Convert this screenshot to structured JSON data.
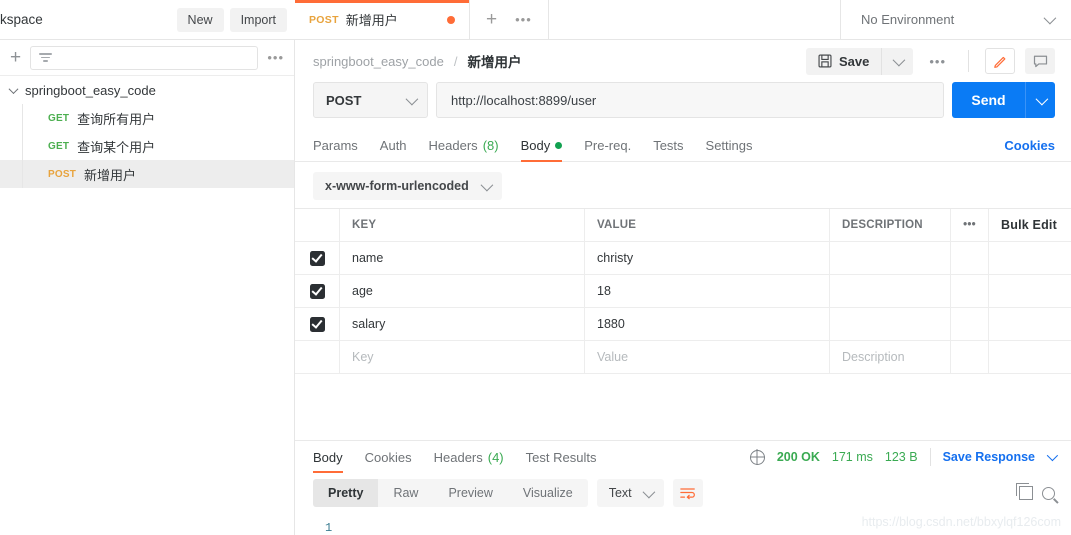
{
  "workspace": {
    "title": "kspace",
    "new_label": "New",
    "import_label": "Import"
  },
  "tabstrip": {
    "tabs": [
      {
        "method": "POST",
        "name": "新增用户",
        "unsaved": true
      }
    ],
    "new_tab_icon": "plus-icon",
    "more_icon": "ellipsis-icon"
  },
  "environment": {
    "selected": "No Environment"
  },
  "sidebar": {
    "add_icon": "plus-icon",
    "filter_placeholder": "",
    "filter_icon": "filter-icon",
    "more_icon": "ellipsis-icon",
    "collection": {
      "name": "springboot_easy_code",
      "expanded": true,
      "requests": [
        {
          "method": "GET",
          "name": "查询所有用户",
          "selected": false
        },
        {
          "method": "GET",
          "name": "查询某个用户",
          "selected": false
        },
        {
          "method": "POST",
          "name": "新增用户",
          "selected": true
        }
      ]
    }
  },
  "breadcrumb": {
    "collection": "springboot_easy_code",
    "separator": "/",
    "request": "新增用户"
  },
  "header_actions": {
    "save_label": "Save",
    "save_icon": "floppy-disk-icon",
    "save_caret_icon": "chevron-down-icon",
    "more_icon": "ellipsis-icon",
    "edit_icon": "pencil-icon",
    "comment_icon": "comment-icon"
  },
  "request": {
    "method": "POST",
    "url": "http://localhost:8899/user",
    "send_label": "Send",
    "tabs": [
      {
        "label": "Params",
        "active": false,
        "count": "",
        "dot": false
      },
      {
        "label": "Auth",
        "active": false,
        "count": "",
        "dot": false
      },
      {
        "label": "Headers",
        "active": false,
        "count": "(8)",
        "dot": false
      },
      {
        "label": "Body",
        "active": true,
        "count": "",
        "dot": true
      },
      {
        "label": "Pre-req.",
        "active": false,
        "count": "",
        "dot": false
      },
      {
        "label": "Tests",
        "active": false,
        "count": "",
        "dot": false
      },
      {
        "label": "Settings",
        "active": false,
        "count": "",
        "dot": false
      }
    ],
    "cookies_link": "Cookies",
    "body_type": "x-www-form-urlencoded"
  },
  "body_table": {
    "headers": {
      "key": "KEY",
      "value": "VALUE",
      "description": "DESCRIPTION",
      "more_icon": "ellipsis-icon",
      "bulk_edit": "Bulk Edit"
    },
    "rows": [
      {
        "checked": true,
        "key": "name",
        "value": "christy",
        "description": ""
      },
      {
        "checked": true,
        "key": "age",
        "value": "18",
        "description": ""
      },
      {
        "checked": true,
        "key": "salary",
        "value": "1880",
        "description": ""
      }
    ],
    "placeholder_row": {
      "key": "Key",
      "value": "Value",
      "description": "Description"
    }
  },
  "response": {
    "tabs": [
      {
        "label": "Body",
        "active": true,
        "count": ""
      },
      {
        "label": "Cookies",
        "active": false,
        "count": ""
      },
      {
        "label": "Headers",
        "active": false,
        "count": "(4)"
      },
      {
        "label": "Test Results",
        "active": false,
        "count": ""
      }
    ],
    "globe_icon": "globe-icon",
    "status": "200 OK",
    "time": "171 ms",
    "size": "123 B",
    "save_response": "Save Response",
    "save_response_caret": "chevron-down-icon",
    "view_modes": [
      {
        "label": "Pretty",
        "active": true
      },
      {
        "label": "Raw",
        "active": false
      },
      {
        "label": "Preview",
        "active": false
      },
      {
        "label": "Visualize",
        "active": false
      }
    ],
    "format": "Text",
    "wrap_icon": "word-wrap-icon",
    "copy_icon": "copy-icon",
    "search_icon": "search-icon",
    "line_number": "1"
  },
  "watermark": "https://blog.csdn.net/bbxylqf126com",
  "colors": {
    "accent_orange": "#ff6c37",
    "send_blue": "#0a7bf5",
    "link_blue": "#1570ef",
    "get_green": "#4caf50",
    "post_orange": "#e8a33d",
    "status_green": "#3aaa52"
  }
}
